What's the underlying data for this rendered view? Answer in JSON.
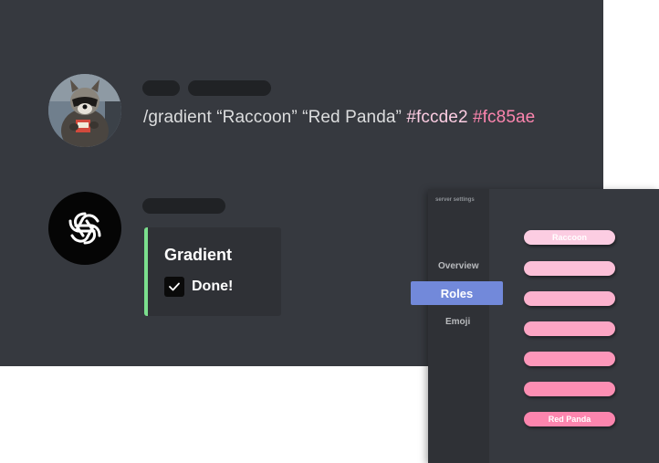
{
  "message": {
    "command_text": "/gradient “Raccoon” “Red Panda”",
    "color_start": "#fccde2",
    "color_end": "#fc85ae"
  },
  "embed": {
    "title": "Gradient",
    "status": "Done!",
    "accent_color": "#7bdf8d"
  },
  "settings": {
    "title": "server settings",
    "nav": {
      "overview": "Overview",
      "roles": "Roles",
      "emoji": "Emoji"
    },
    "roles": [
      {
        "name": "Raccoon",
        "color": "#fccde2"
      },
      {
        "name": "",
        "color": "#fcc0d8"
      },
      {
        "name": "",
        "color": "#fcb2ce"
      },
      {
        "name": "",
        "color": "#fca5c4"
      },
      {
        "name": "",
        "color": "#fc97ba"
      },
      {
        "name": "",
        "color": "#fc8eb3"
      },
      {
        "name": "Red Panda",
        "color": "#fc85ae"
      }
    ]
  },
  "icons": {
    "user_avatar": "raccoon-avatar",
    "bot_avatar": "openai-knot-icon",
    "checkbox": "check-icon"
  }
}
